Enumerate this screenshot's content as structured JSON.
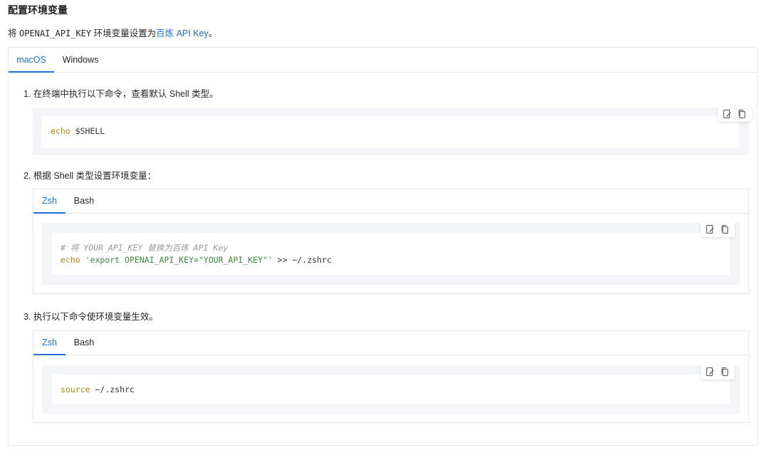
{
  "section": {
    "title": "配置环境变量",
    "intro_prefix": "将 ",
    "intro_code": "OPENAI_API_KEY",
    "intro_middle": " 环境变量设置为",
    "intro_link": "百炼 API Key",
    "intro_suffix": "。"
  },
  "os_tabs": [
    {
      "label": "macOS",
      "active": true
    },
    {
      "label": "Windows",
      "active": false
    }
  ],
  "steps": [
    {
      "text": "1. 在终端中执行以下命令，查看默认 Shell 类型。"
    },
    {
      "text": "2. 根据 Shell 类型设置环境变量："
    },
    {
      "text": "3. 执行以下命令使环境变量生效。"
    }
  ],
  "code_blocks": {
    "step1": {
      "keyword": "echo",
      "rest": " $SHELL"
    },
    "step2": {
      "comment": "# 将 YOUR_API_KEY 替换为百炼 API Key",
      "keyword": "echo",
      "string": "'export OPENAI_API_KEY=\"YOUR_API_KEY\"'",
      "rest": " >> ~/.zshrc"
    },
    "step3": {
      "keyword": "source",
      "rest": " ~/.zshrc"
    }
  },
  "shell_tabs": [
    {
      "label": "Zsh",
      "active": true
    },
    {
      "label": "Bash",
      "active": false
    }
  ],
  "colors": {
    "accent": "#1f6fd6",
    "keyword": "#b8860b",
    "string": "#3b8a3b",
    "comment": "#9a9a9a",
    "code_bg": "#f3f5f8",
    "border": "#e6e8eb"
  },
  "icons": [
    "edit-icon",
    "copy-icon"
  ]
}
